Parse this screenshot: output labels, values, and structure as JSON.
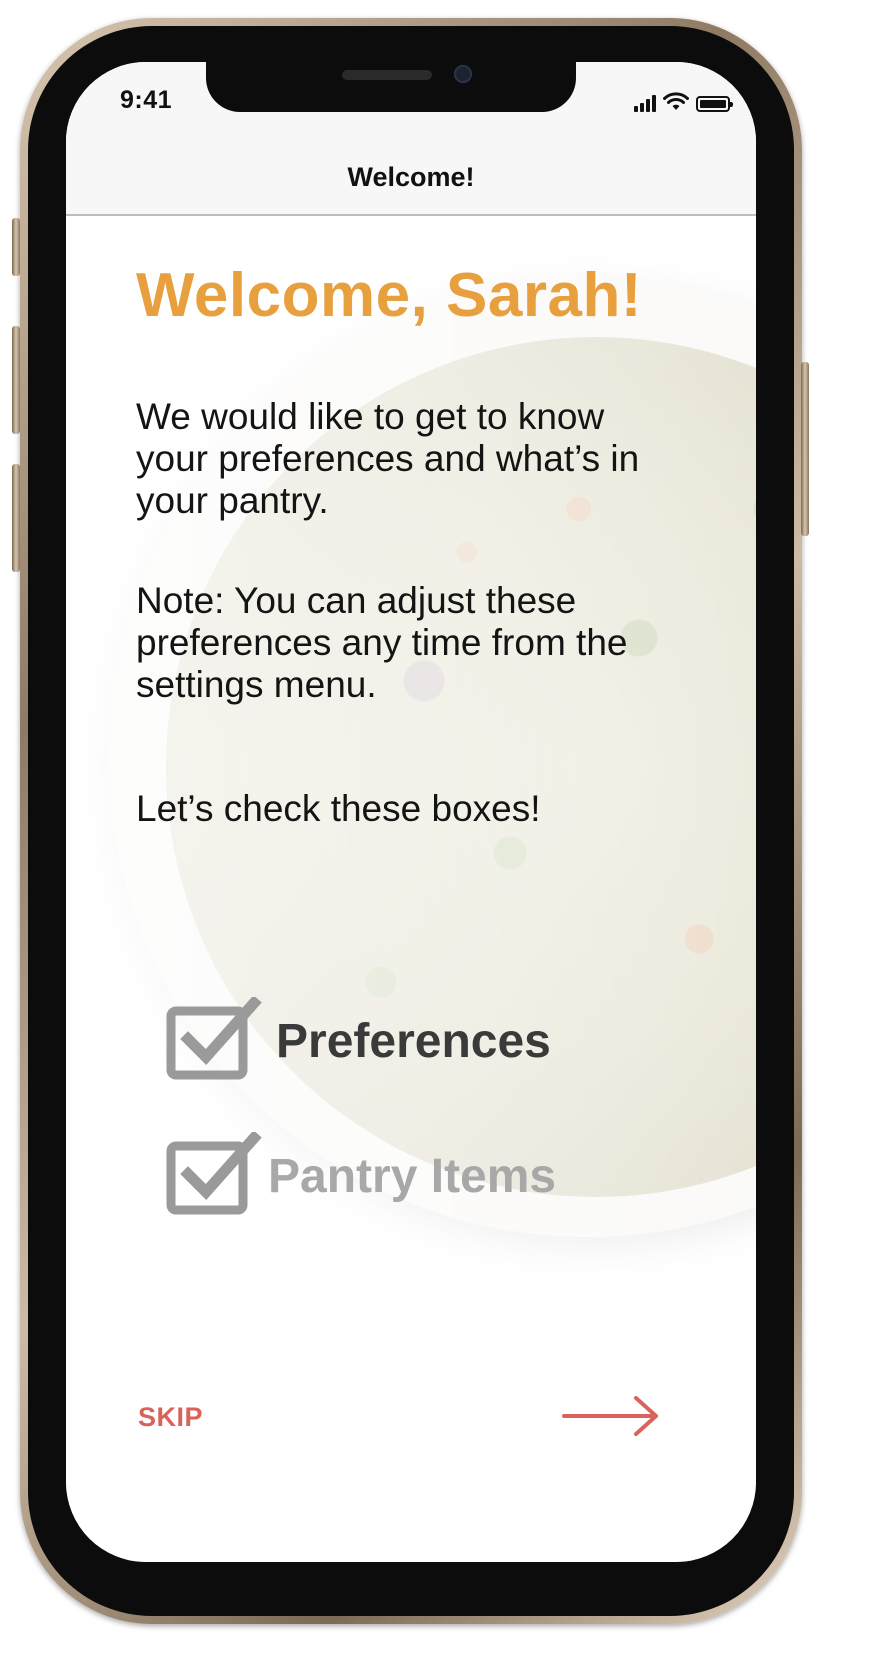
{
  "status_bar": {
    "time": "9:41",
    "icons": [
      "cellular-signal-icon",
      "wifi-icon",
      "battery-icon"
    ]
  },
  "nav": {
    "title": "Welcome!"
  },
  "main": {
    "heading": "Welcome, Sarah!",
    "intro": "We would like to get to know your preferences and what’s in your pantry.",
    "note": "Note: You can adjust these preferences any time from the settings menu.",
    "prompt": "Let’s check these boxes!",
    "checklist": [
      {
        "label": "Preferences",
        "icon": "checkbox-checked-icon",
        "state": "active"
      },
      {
        "label": "Pantry Items",
        "icon": "checkbox-checked-icon",
        "state": "dimmed"
      }
    ]
  },
  "footer": {
    "skip_label": "SKIP",
    "next_icon": "arrow-right-icon"
  },
  "colors": {
    "heading": "#e8a03e",
    "accent": "#d9625a",
    "checkbox": "#9a9a9a",
    "text": "#141414"
  }
}
